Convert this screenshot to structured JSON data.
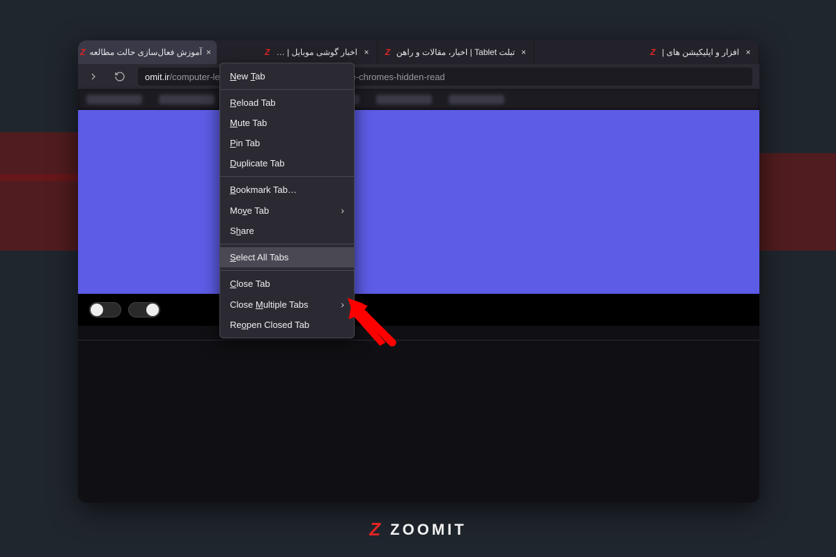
{
  "tabs": [
    {
      "title": "آموزش فعال‌سازی حالت مطالعه",
      "icon": "z"
    },
    {
      "title": "اخبار گوشی موبایل | …",
      "icon": "z"
    },
    {
      "title": "تبلت Tablet | اخبار، مقالات و راهن",
      "icon": "z"
    },
    {
      "title": "افزار و اپلیکیشن های |",
      "icon": "z"
    }
  ],
  "url": {
    "host": "omit.ir",
    "path": "/computer-learning/337783-how-to-use-google-chromes-hidden-read"
  },
  "context_menu": {
    "new_tab": "New Tab",
    "reload_tab": "Reload Tab",
    "mute_tab": "Mute Tab",
    "pin_tab": "Pin Tab",
    "duplicate_tab": "Duplicate Tab",
    "bookmark_tab": "Bookmark Tab…",
    "move_tab": "Move Tab",
    "share": "Share",
    "select_all_tabs": "Select All Tabs",
    "close_tab": "Close Tab",
    "close_multiple_tabs": "Close Multiple Tabs",
    "reopen_closed_tab": "Reopen Closed Tab"
  },
  "brand": "ZOOMIT",
  "colors": {
    "accent_red": "#e02424",
    "page_purple": "#5d5ce6",
    "menu_bg": "#2b2a33"
  }
}
